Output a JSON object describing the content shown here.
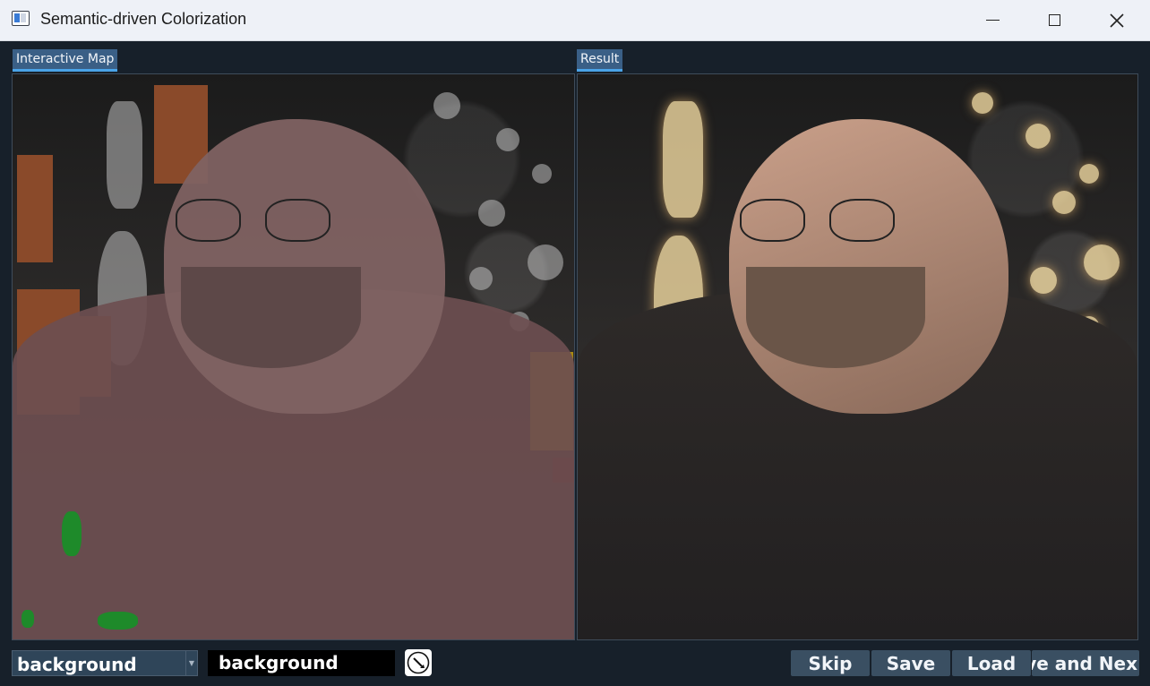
{
  "window": {
    "title": "Semantic-driven Colorization",
    "icon": "app-window-icon",
    "controls": [
      "minimize-icon",
      "maximize-icon",
      "close-icon"
    ]
  },
  "panels": {
    "left_tab": "Interactive Map",
    "right_tab": "Result"
  },
  "toolbar": {
    "class_select_value": "background",
    "current_label": "background",
    "picker_icon": "color-picker-icon",
    "skip_label": "Skip",
    "save_label": "Save",
    "load_label": "Load",
    "next_label": "ave and Nex"
  },
  "colors": {
    "window_bg": "#17202a",
    "titlebar_bg": "#eef1f7",
    "tab_bg": "#3a5f86",
    "tab_underline": "#4aa3e8",
    "button_bg": "#3a4f62",
    "segment_person": "#6c4e50",
    "segment_orange": "#8a4a2a",
    "segment_yellow": "#a98a10",
    "segment_green": "#1e8a2a"
  }
}
